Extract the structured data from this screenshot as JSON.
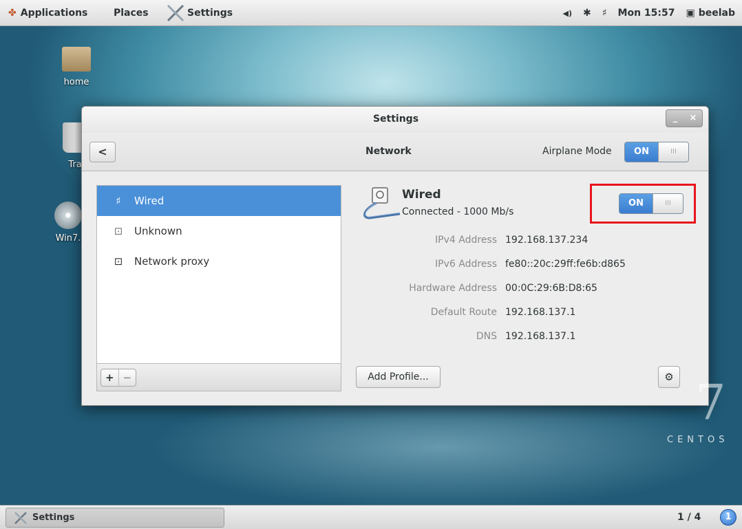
{
  "topbar": {
    "applications_label": "Applications",
    "places_label": "Places",
    "settings_label": "Settings",
    "volume_icon": "◀)",
    "bluetooth_icon": "✱",
    "network_icon": "♯",
    "clock": "Mon 15:57",
    "user": "beelab"
  },
  "desktop": {
    "home_label": "home",
    "trash_label": "Tra",
    "disc_label": "Win7."
  },
  "window": {
    "title": "Settings",
    "minimize": "_",
    "close": "×",
    "back_glyph": "<",
    "page_title": "Network",
    "airplane_label": "Airplane Mode",
    "airplane_state": "ON",
    "knob_glyph": "III"
  },
  "sidebar": {
    "items": [
      {
        "label": "Wired",
        "icon": "♯",
        "selected": true
      },
      {
        "label": "Unknown",
        "icon": "⊡"
      },
      {
        "label": "Network proxy",
        "icon": "⊡"
      }
    ],
    "add_glyph": "+",
    "remove_glyph": "−"
  },
  "device": {
    "name": "Wired",
    "status": "Connected - 1000 Mb/s",
    "switch_state": "ON",
    "details": [
      {
        "label": "IPv4 Address",
        "value": "192.168.137.234"
      },
      {
        "label": "IPv6 Address",
        "value": "fe80::20c:29ff:fe6b:d865"
      },
      {
        "label": "Hardware Address",
        "value": "00:0C:29:6B:D8:65"
      },
      {
        "label": "Default Route",
        "value": "192.168.137.1"
      },
      {
        "label": "DNS",
        "value": "192.168.137.1"
      }
    ],
    "add_profile_label": "Add Profile...",
    "gear_glyph": "⚙"
  },
  "branding": {
    "seven": "7",
    "centos": "CENTOS"
  },
  "taskbar": {
    "task_label": "Settings",
    "pager": "1 / 4",
    "badge": "1"
  }
}
